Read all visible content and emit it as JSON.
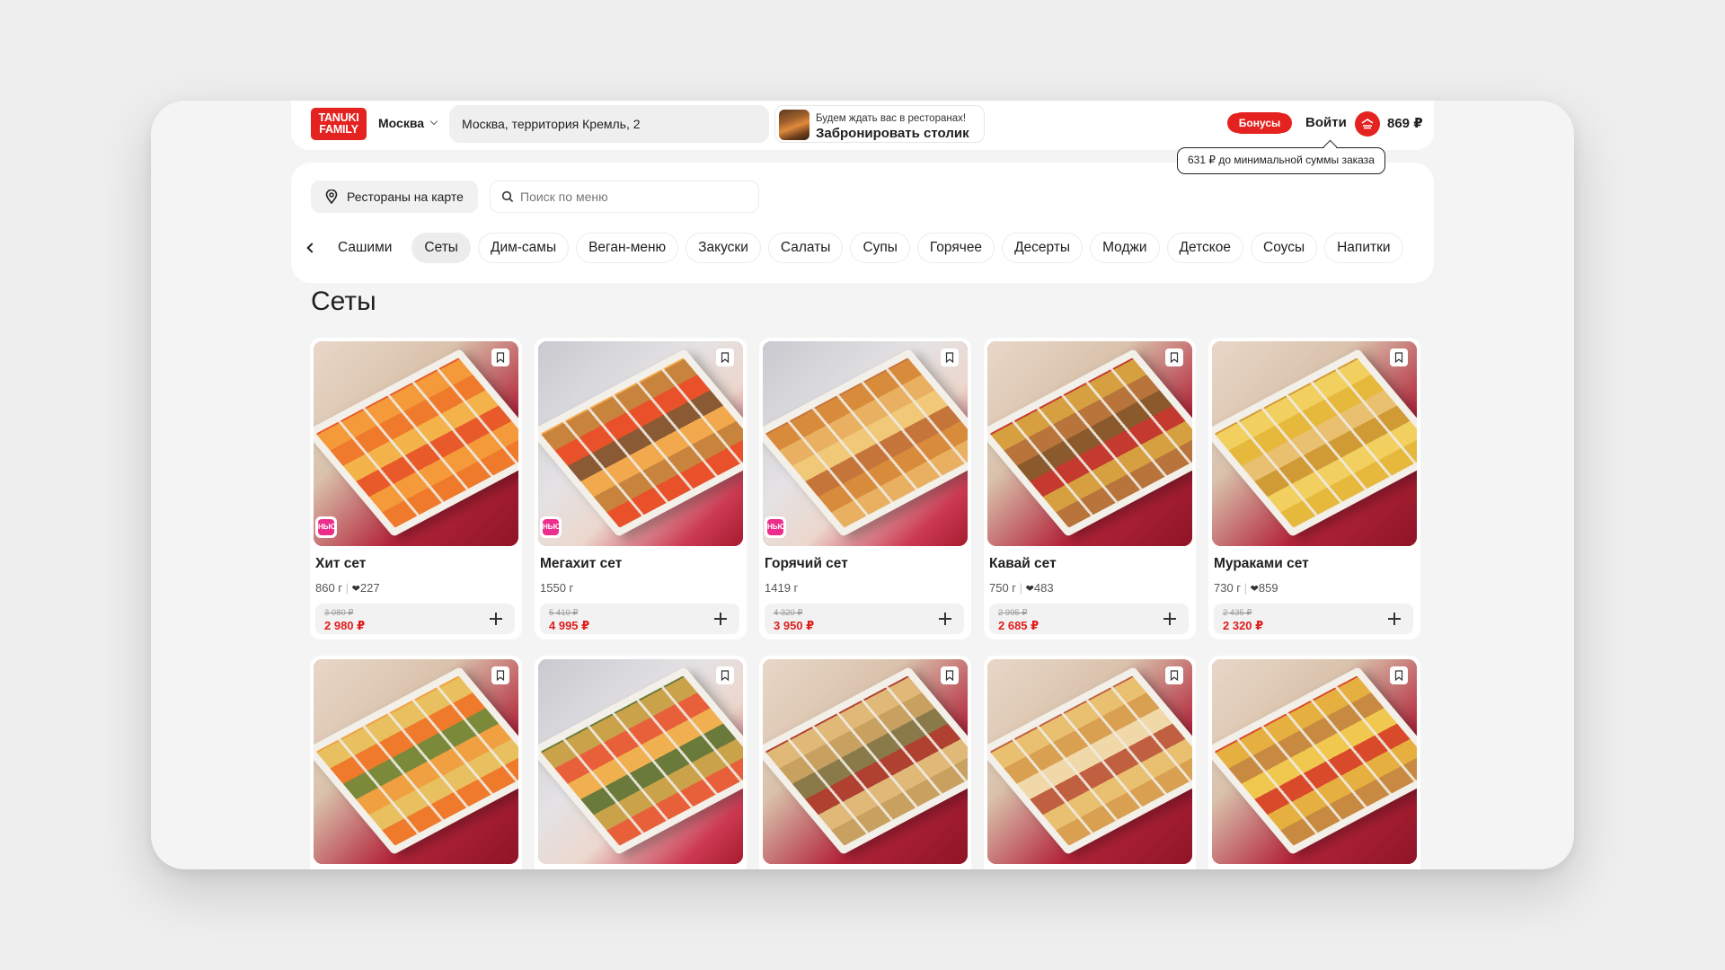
{
  "brand": {
    "logo_line1": "TANUKI",
    "logo_line2": "FAMILY",
    "accent": "#e42320"
  },
  "header": {
    "city": "Москва",
    "address": "Москва, территория Кремль, 2",
    "booking_subtitle": "Будем ждать вас в ресторанах!",
    "booking_title": "Забронировать столик",
    "bonus_label": "Бонусы",
    "login_label": "Войти",
    "cart_sum": "869 ₽",
    "tooltip": "631 ₽ до минимальной суммы заказа"
  },
  "toolbar": {
    "map_label": "Рестораны на карте",
    "search_placeholder": "Поиск по меню"
  },
  "categories": [
    {
      "label": "Сашими",
      "active": false
    },
    {
      "label": "Сеты",
      "active": true
    },
    {
      "label": "Дим-самы",
      "active": false
    },
    {
      "label": "Веган-меню",
      "active": false
    },
    {
      "label": "Закуски",
      "active": false
    },
    {
      "label": "Салаты",
      "active": false
    },
    {
      "label": "Супы",
      "active": false
    },
    {
      "label": "Горячее",
      "active": false
    },
    {
      "label": "Десерты",
      "active": false
    },
    {
      "label": "Моджи",
      "active": false
    },
    {
      "label": "Детское",
      "active": false
    },
    {
      "label": "Соусы",
      "active": false
    },
    {
      "label": "Напитки",
      "active": false
    }
  ],
  "section_title": "Сеты",
  "new_badge_label": "НЬЮ",
  "products": [
    {
      "name": "Хит сет",
      "weight": "860 г",
      "likes": "227",
      "old_price": "3 080 ₽",
      "price": "2 980 ₽",
      "is_new": true,
      "palette": [
        "#f07a2c",
        "#f49a3a",
        "#e85a2a",
        "#f3b24a"
      ]
    },
    {
      "name": "Мегахит сет",
      "weight": "1550 г",
      "likes": "",
      "old_price": "5 410 ₽",
      "price": "4 995 ₽",
      "is_new": true,
      "palette": [
        "#e8512a",
        "#c8833c",
        "#f2a84c",
        "#8a5a34"
      ]
    },
    {
      "name": "Горячий сет",
      "weight": "1419 г",
      "likes": "",
      "old_price": "4 320 ₽",
      "price": "3 950 ₽",
      "is_new": true,
      "palette": [
        "#e8b060",
        "#d98b3c",
        "#c6753a",
        "#f0c878"
      ]
    },
    {
      "name": "Кавай сет",
      "weight": "750 г",
      "likes": "483",
      "old_price": "2 995 ₽",
      "price": "2 685 ₽",
      "is_new": false,
      "palette": [
        "#b8743a",
        "#d6a040",
        "#c43a2e",
        "#8a5a2c"
      ]
    },
    {
      "name": "Мураками сет",
      "weight": "730 г",
      "likes": "859",
      "old_price": "2 435 ₽",
      "price": "2 320 ₽",
      "is_new": false,
      "palette": [
        "#e6b83c",
        "#f2d060",
        "#d09a34",
        "#e8c070"
      ]
    }
  ],
  "products_row2_palettes": [
    [
      "#f07a2c",
      "#e8c060",
      "#f0a040",
      "#7a8a3a"
    ],
    [
      "#e8603a",
      "#c9a24a",
      "#6a7a3a",
      "#f0b050"
    ],
    [
      "#c8a060",
      "#e0b878",
      "#b04030",
      "#8a7a4a"
    ],
    [
      "#d8a050",
      "#e8c070",
      "#c06040",
      "#f0d8a8"
    ],
    [
      "#c88a40",
      "#e6b040",
      "#d84a2a",
      "#f0c850"
    ]
  ]
}
